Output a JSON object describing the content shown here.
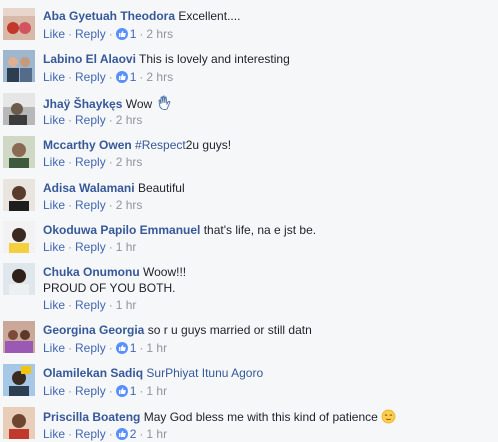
{
  "actions": {
    "like": "Like",
    "reply": "Reply",
    "sep": "·"
  },
  "colors": {
    "link": "#365899",
    "action": "#4267b2",
    "meta": "#90949c",
    "like_badge": "#5890ff"
  },
  "comments": [
    {
      "name": "Aba Gyetuah Theodora",
      "text": "Excellent....",
      "likes": "1",
      "time": "2 hrs",
      "avatar": "avatar-photo"
    },
    {
      "name": "Labino El Alaovi",
      "text": "This is lovely and interesting",
      "likes": "1",
      "time": "2 hrs",
      "avatar": "avatar-photo"
    },
    {
      "name": "Jhaÿ Šhaykęs",
      "text": "Wow",
      "emoji": "waving-hand-icon",
      "time": "2 hrs",
      "avatar": "avatar-photo"
    },
    {
      "name": "Mccarthy Owen",
      "hashtag": "#Respect",
      "text": "2u guys!",
      "time": "2 hrs",
      "avatar": "avatar-photo"
    },
    {
      "name": "Adisa Walamani",
      "text": "Beautiful",
      "time": "2 hrs",
      "avatar": "avatar-photo"
    },
    {
      "name": "Okoduwa Papilo Emmanuel",
      "text": "that's life, na e jst be.",
      "time": "1 hr",
      "avatar": "avatar-photo"
    },
    {
      "name": "Chuka Onumonu",
      "text": "Woow!!!",
      "text2": "PROUD OF YOU BOTH.",
      "time": "1 hr",
      "avatar": "avatar-photo"
    },
    {
      "name": "Georgina Georgia",
      "text": "so r u guys married or still datn",
      "likes": "1",
      "time": "1 hr",
      "avatar": "avatar-photo"
    },
    {
      "name": "Olamilekan Sadiq",
      "mention": "SurPhiyat Itunu Agoro",
      "likes": "1",
      "time": "1 hr",
      "avatar": "avatar-photo"
    },
    {
      "name": "Priscilla Boateng",
      "text": "May God bless me with this kind of patience",
      "emoji": "relieved-face-icon",
      "likes": "2",
      "time": "1 hr",
      "avatar": "avatar-photo"
    }
  ]
}
